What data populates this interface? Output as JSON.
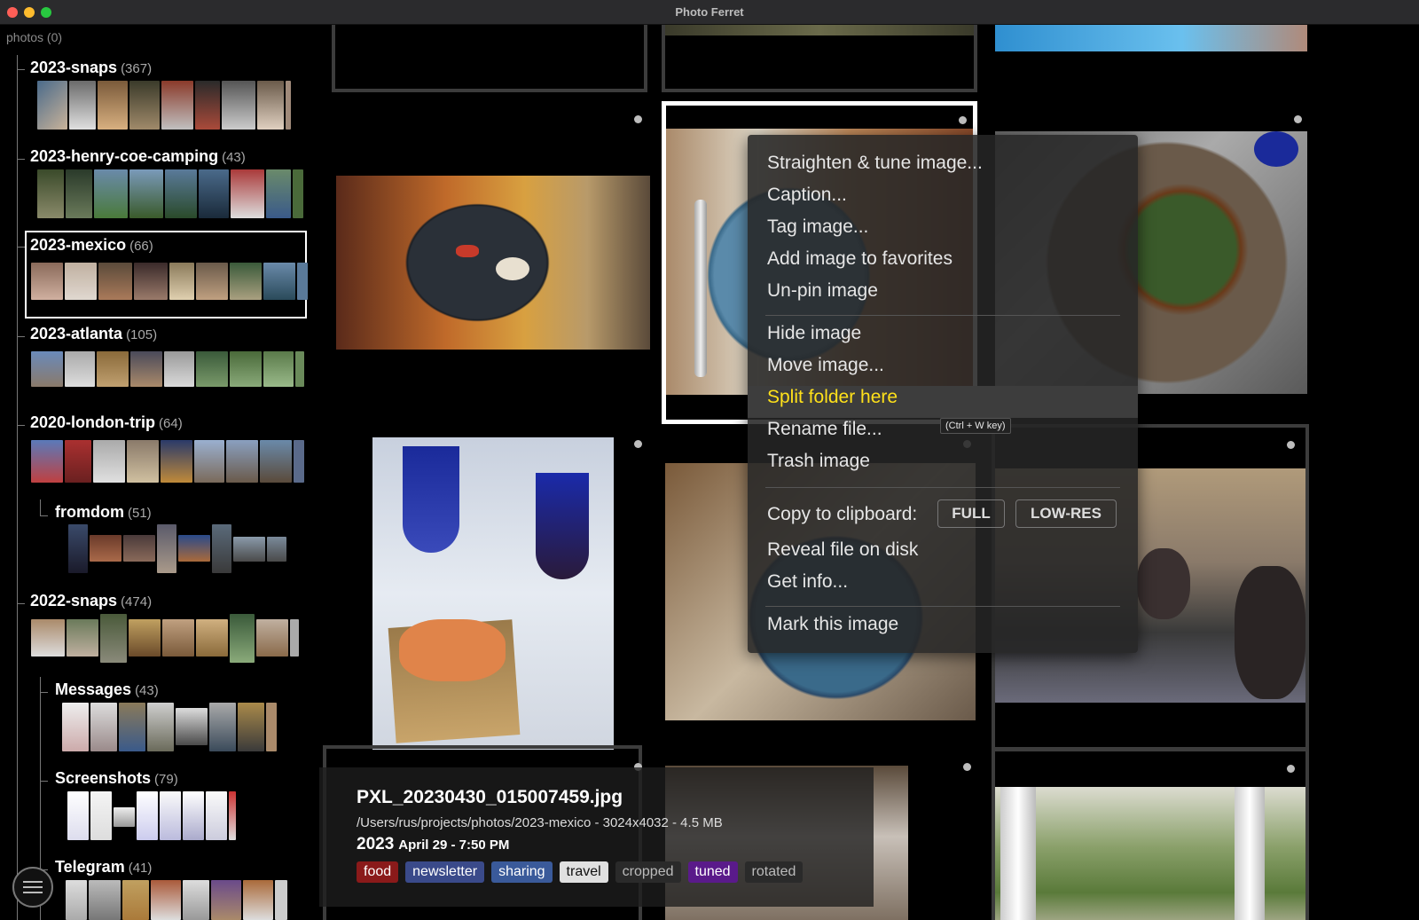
{
  "window": {
    "title": "Photo Ferret"
  },
  "sidebar": {
    "root_label": "photos (0)",
    "folders": [
      {
        "name": "2023-snaps",
        "count": "(367)"
      },
      {
        "name": "2023-henry-coe-camping",
        "count": "(43)"
      },
      {
        "name": "2023-mexico",
        "count": "(66)"
      },
      {
        "name": "2023-atlanta",
        "count": "(105)"
      },
      {
        "name": "2020-london-trip",
        "count": "(64)"
      },
      {
        "name": "fromdom",
        "count": "(51)"
      },
      {
        "name": "2022-snaps",
        "count": "(474)"
      },
      {
        "name": "Messages",
        "count": "(43)"
      },
      {
        "name": "Screenshots",
        "count": "(79)"
      },
      {
        "name": "Telegram",
        "count": "(41)"
      }
    ]
  },
  "context_menu": {
    "items": [
      "Straighten & tune image...",
      "Caption...",
      "Tag image...",
      "Add image to favorites",
      "Un-pin image",
      "Hide image",
      "Move image...",
      "Split folder here",
      "Rename file...",
      "Trash image",
      "Copy to clipboard:",
      "Reveal file on disk",
      "Get info...",
      "Mark this image"
    ],
    "shortcut_hint": "(Ctrl + W key)",
    "clipboard_full": "FULL",
    "clipboard_lowres": "LOW-RES"
  },
  "info": {
    "filename": "PXL_20230430_015007459.jpg",
    "path_line": "/Users/rus/projects/photos/2023-mexico  - 3024x4032  - 4.5 MB",
    "year": "2023",
    "date_rest": "April 29  - 7:50 PM",
    "tags": [
      {
        "label": "food",
        "color": "#8a1a1a"
      },
      {
        "label": "newsletter",
        "color": "#3a4a8a"
      },
      {
        "label": "sharing",
        "color": "#3a5a9a"
      },
      {
        "label": "travel",
        "color": "#e0e0e0"
      },
      {
        "label": "cropped",
        "color": "#2a2a2a"
      },
      {
        "label": "tuned",
        "color": "#5a1a8a"
      },
      {
        "label": "rotated",
        "color": "#2a2a2a"
      }
    ]
  },
  "colors": {
    "highlight_text": "#ffe11a",
    "selection_border": "#ffffff"
  }
}
